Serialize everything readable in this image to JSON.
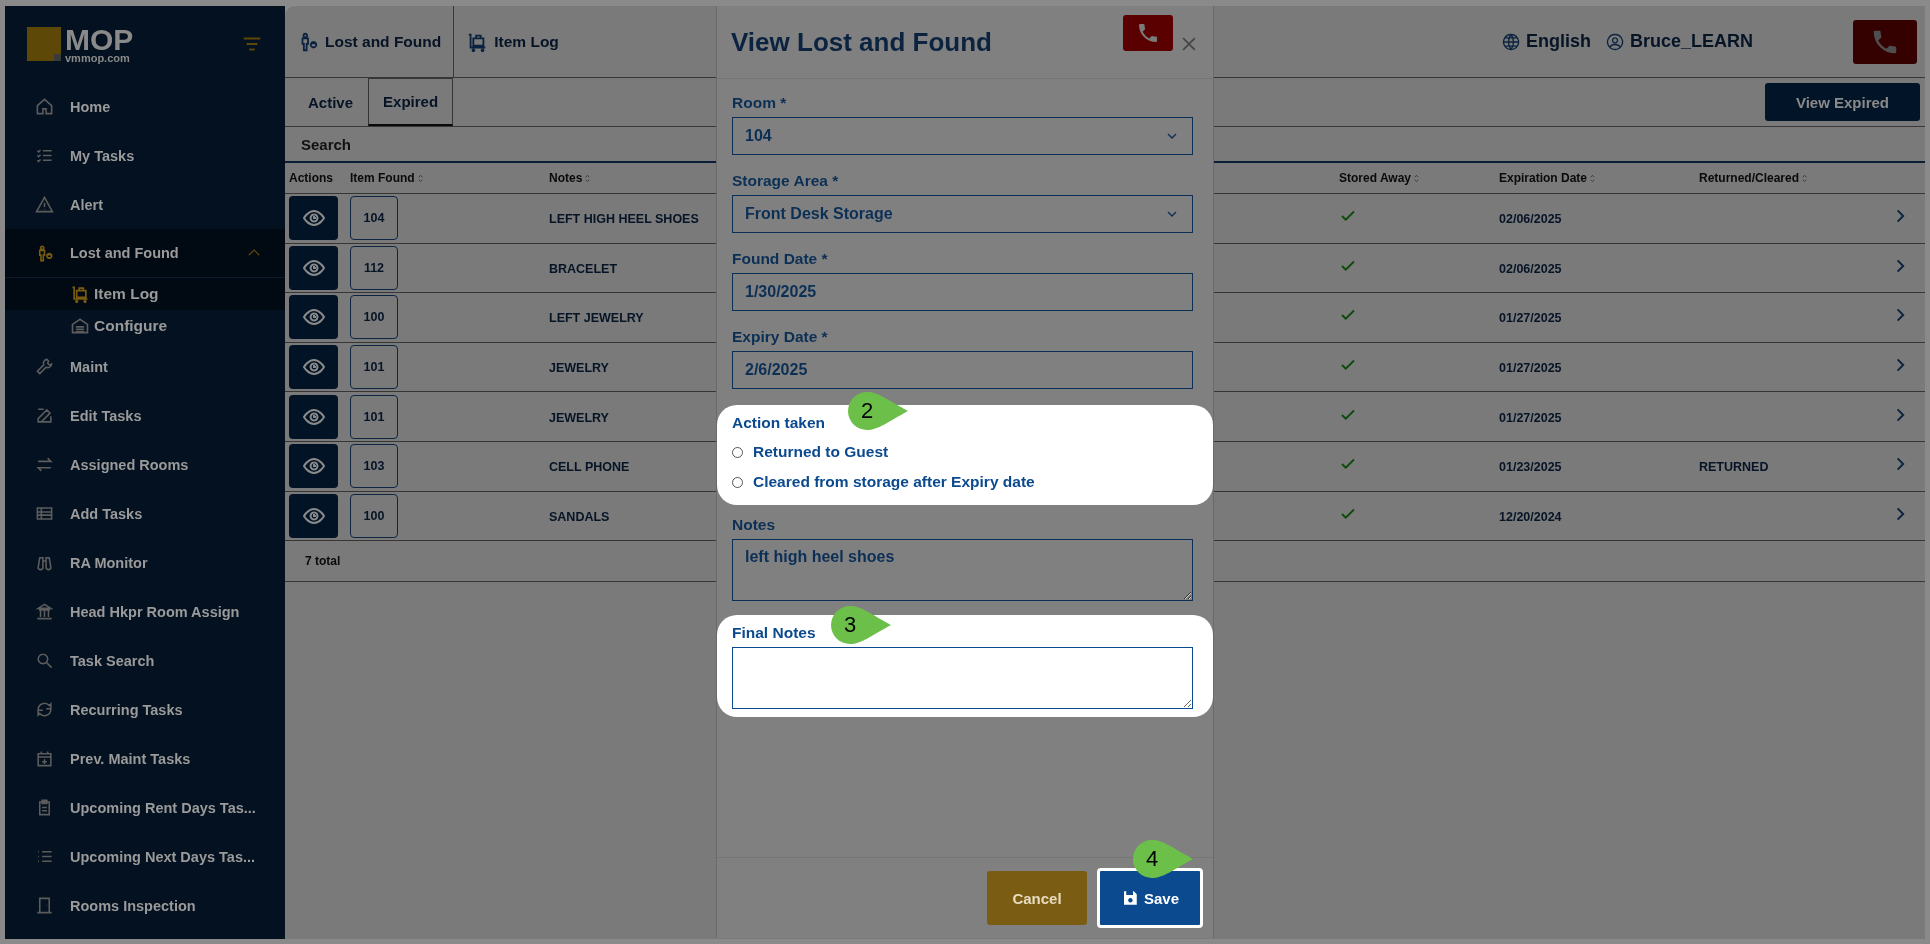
{
  "sidebar": {
    "logo": {
      "brand": "MOP",
      "domain": "vmmop.com"
    },
    "items": [
      {
        "label": "Home",
        "selected": false
      },
      {
        "label": "My Tasks",
        "selected": false
      },
      {
        "label": "Alert",
        "selected": false
      },
      {
        "label": "Lost and Found",
        "selected": true,
        "expanded": true,
        "children": [
          {
            "label": "Item Log",
            "selected": true
          },
          {
            "label": "Configure",
            "selected": false
          }
        ]
      },
      {
        "label": "Maint",
        "selected": false
      },
      {
        "label": "Edit Tasks",
        "selected": false
      },
      {
        "label": "Assigned Rooms",
        "selected": false
      },
      {
        "label": "Add Tasks",
        "selected": false
      },
      {
        "label": "RA Monitor",
        "selected": false
      },
      {
        "label": "Head Hkpr Room Assign",
        "selected": false
      },
      {
        "label": "Task Search",
        "selected": false
      },
      {
        "label": "Recurring Tasks",
        "selected": false
      },
      {
        "label": "Prev. Maint Tasks",
        "selected": false
      },
      {
        "label": "Upcoming Rent Days Tas...",
        "selected": false
      },
      {
        "label": "Upcoming Next Days Tas...",
        "selected": false
      },
      {
        "label": "Rooms Inspection",
        "selected": false
      }
    ]
  },
  "header": {
    "breadcrumbs": [
      "Lost and Found",
      "Item Log"
    ],
    "language": "English",
    "user": "Bruce_LEARN"
  },
  "tabs": [
    {
      "label": "Active",
      "selected": false
    },
    {
      "label": "Expired",
      "selected": true
    }
  ],
  "view_button": "View Expired",
  "search": {
    "placeholder": "Search"
  },
  "table": {
    "columns": [
      {
        "label": "Actions",
        "sortable": false
      },
      {
        "label": "Item Found",
        "sortable": true
      },
      {
        "label": "Notes",
        "sortable": true
      },
      {
        "label": "Stored Away",
        "sortable": true
      },
      {
        "label": "Expiration Date",
        "sortable": true
      },
      {
        "label": "Returned/Cleared",
        "sortable": true
      }
    ],
    "rows": [
      {
        "room": "104",
        "notes": "LEFT HIGH HEEL SHOES",
        "stored_away": true,
        "expiration": "02/06/2025"
      },
      {
        "room": "112",
        "notes": "BRACELET",
        "stored_away": true,
        "expiration": "02/06/2025"
      },
      {
        "room": "100",
        "notes": "LEFT JEWELRY",
        "stored_away": true,
        "expiration": "01/27/2025"
      },
      {
        "room": "101",
        "notes": "JEWELRY",
        "stored_away": true,
        "expiration": "01/27/2025"
      },
      {
        "room": "101",
        "notes": "JEWELRY",
        "stored_away": true,
        "expiration": "01/27/2025"
      },
      {
        "room": "103",
        "notes": "CELL PHONE",
        "stored_away": true,
        "expiration": "01/23/2025",
        "returned": "RETURNED"
      },
      {
        "room": "100",
        "notes": "SANDALS",
        "stored_away": true,
        "expiration": "12/20/2024"
      }
    ],
    "total": "7 total"
  },
  "modal": {
    "title": "View Lost and Found",
    "fields": [
      {
        "kind": "select",
        "label": "Room *",
        "value": "104"
      },
      {
        "kind": "select",
        "label": "Storage Area *",
        "value": "Front Desk Storage"
      },
      {
        "kind": "text",
        "label": "Found Date *",
        "value": "1/30/2025"
      },
      {
        "kind": "text",
        "label": "Expiry Date *",
        "value": "2/6/2025"
      }
    ],
    "action_taken": {
      "label": "Action taken",
      "highlighted": true,
      "options": [
        {
          "label": "Returned to Guest",
          "selected": false
        },
        {
          "label": "Cleared from storage after Expiry date",
          "selected": false
        }
      ]
    },
    "notes": {
      "label": "Notes",
      "value": "left high heel shoes"
    },
    "final_notes": {
      "label": "Final Notes",
      "highlighted": true
    },
    "buttons": {
      "cancel": "Cancel",
      "save": "Save",
      "save_highlighted": true
    }
  },
  "callouts": [
    "2",
    "3",
    "4"
  ]
}
